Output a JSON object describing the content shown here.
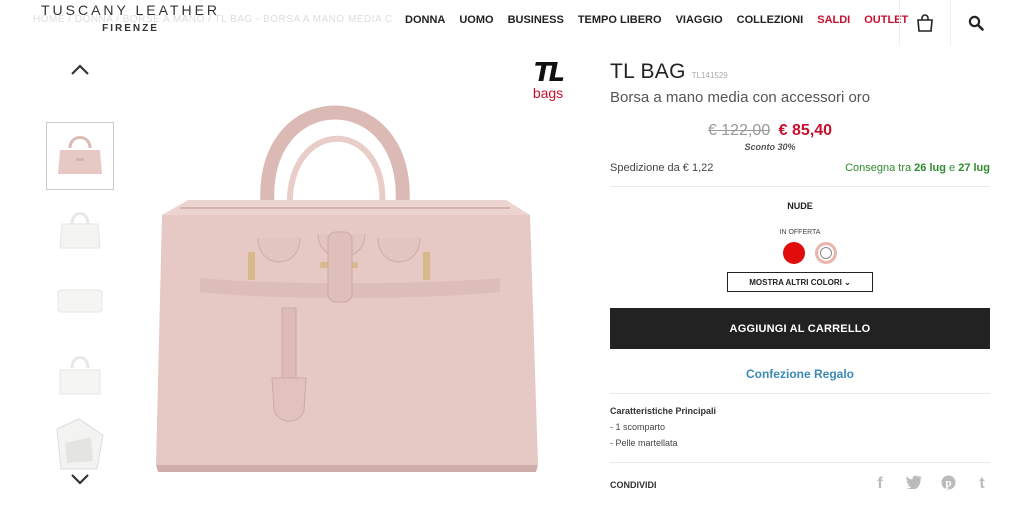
{
  "header": {
    "brand": "TUSCANY LEATHER",
    "brand_sub": "FIRENZE",
    "breadcrumb": "HOME / DONNA / BORSE A MANO / TL BAG - BORSA A MANO MEDIA CON ACCESSORI ORO",
    "nav": [
      "DONNA",
      "UOMO",
      "BUSINESS",
      "TEMPO LIBERO",
      "VIAGGIO",
      "COLLEZIONI",
      "SALDI",
      "OUTLET"
    ],
    "cart_icon": "shopping-bag-icon",
    "search_icon": "search-icon"
  },
  "gallery": {
    "thumbnails": [
      "bag-front-nude",
      "bag-white",
      "wallet-white",
      "bag-white-side",
      "bag-interior"
    ],
    "selected": 0
  },
  "brand_logo": {
    "mark": "TL",
    "text": "bags"
  },
  "product": {
    "title": "TL BAG",
    "code": "TL141529",
    "subtitle": "Borsa a mano media con accessori oro",
    "old_price": "€ 122,00",
    "new_price": "€ 85,40",
    "discount": "Sconto 30%",
    "shipping": "Spedizione da € 1,22",
    "delivery_prefix": "Consegna tra ",
    "delivery_from": "26 lug",
    "delivery_and": " e ",
    "delivery_to": "27 lug",
    "color_name": "NUDE",
    "offer_label": "IN OFFERTA",
    "swatches": [
      {
        "name": "Rosso",
        "color": "#e10d0d"
      },
      {
        "name": "Nude",
        "color": "#e9b5ad"
      }
    ],
    "more_colors": "MOSTRA ALTRI COLORI",
    "add_to_cart": "AGGIUNGI AL CARRELLO",
    "gift": "Confezione Regalo",
    "features_title": "Caratteristiche Principali",
    "features": [
      "- 1 scomparto",
      "- Pelle martellata"
    ],
    "share_label": "CONDIVIDI",
    "social": [
      "facebook-icon",
      "twitter-icon",
      "pinterest-icon",
      "tumblr-icon"
    ]
  },
  "colors": {
    "accent_red": "#c8102e",
    "nude": "#e6c9c5",
    "delivery_green": "#2e8b2e",
    "gift_blue": "#3a8ab5",
    "button_dark": "#222222"
  }
}
